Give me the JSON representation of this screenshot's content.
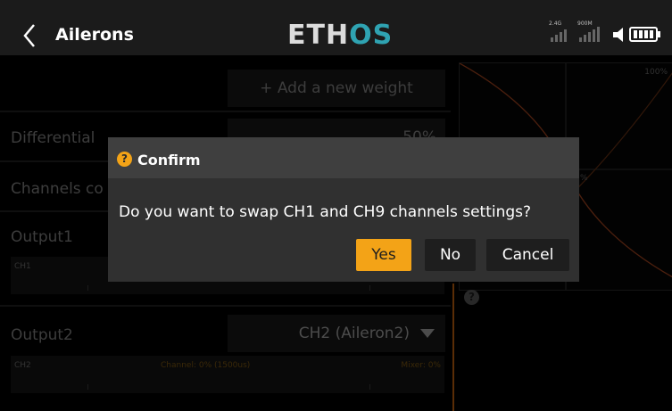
{
  "header": {
    "title": "Ailerons",
    "logo_main": "ETH",
    "logo_accent": "OS",
    "status": {
      "band_24": "2.4G",
      "band_900": "900M"
    }
  },
  "panel": {
    "add_weight_label": "+ Add a new weight",
    "differential_label": "Differential",
    "differential_value": "50%",
    "channels_label": "Channels co",
    "output1_label": "Output1",
    "output1_bar_channel": "CH1",
    "output2_label": "Output2",
    "output2_value": "CH2 (Aileron2)",
    "output2_bar_channel": "CH2",
    "output2_bar_channel_info": "Channel: 0% (1500us)",
    "output2_bar_mixer_info": "Mixer: 0%"
  },
  "graph": {
    "top_label": "100%",
    "mid_label": "%"
  },
  "dialog": {
    "title": "Confirm",
    "message": "Do you want to swap CH1 and CH9 channels settings?",
    "yes_label": "Yes",
    "no_label": "No",
    "cancel_label": "Cancel"
  },
  "colors": {
    "accent": "#f3a317",
    "logo_accent": "#2fa3b2",
    "curve": "#8a3a1a"
  }
}
